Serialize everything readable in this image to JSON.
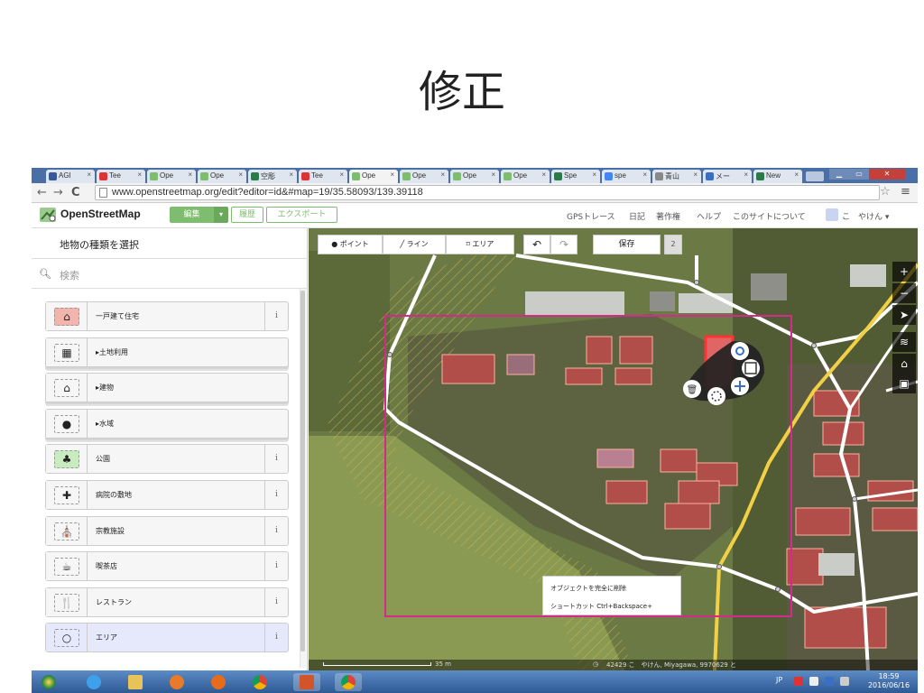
{
  "slide": {
    "title": "修正"
  },
  "browser": {
    "tabs": [
      {
        "label": "AGI",
        "color": "#3b5998"
      },
      {
        "label": "Tee",
        "color": "#d33"
      },
      {
        "label": "Ope",
        "color": "#7ebc6f"
      },
      {
        "label": "Ope",
        "color": "#7ebc6f"
      },
      {
        "label": "空彫",
        "color": "#2a7a4a"
      },
      {
        "label": "Tee",
        "color": "#d33"
      },
      {
        "label": "Ope",
        "color": "#7ebc6f"
      },
      {
        "label": "Ope",
        "color": "#7ebc6f"
      },
      {
        "label": "Ope",
        "color": "#7ebc6f"
      },
      {
        "label": "Ope",
        "color": "#7ebc6f"
      },
      {
        "label": "Spe",
        "color": "#2a7a4a"
      },
      {
        "label": "spe",
        "color": "#4285f4"
      },
      {
        "label": "青山",
        "color": "#888"
      },
      {
        "label": "メー",
        "color": "#3a6fc4"
      },
      {
        "label": "New",
        "color": "#2a7a4a"
      }
    ],
    "active_tab_index": 6,
    "url": "www.openstreetmap.org/edit?editor=id&#map=19/35.58093/139.39118"
  },
  "osm_header": {
    "logo": "OpenStreetMap",
    "edit": "編集",
    "dropdown": "▾",
    "history": "履歴",
    "export": "エクスポート",
    "links": [
      "GPSトレース",
      "日記",
      "著作権",
      "ヘルプ",
      "このサイトについて"
    ],
    "user": "こ　やけん ▾"
  },
  "sidebar": {
    "heading": "地物の種類を選択",
    "search_placeholder": "検索",
    "presets": [
      {
        "label": "一戸建て住宅",
        "icon": "house-icon",
        "info": "i",
        "group": false,
        "bg": "#f2b5ad"
      },
      {
        "label": "▸土地利用",
        "icon": "landuse-icon",
        "info": "",
        "group": true,
        "bg": ""
      },
      {
        "label": "▸建物",
        "icon": "building-icon",
        "info": "",
        "group": true,
        "bg": ""
      },
      {
        "label": "▸水域",
        "icon": "water-icon",
        "info": "",
        "group": true,
        "bg": ""
      },
      {
        "label": "公園",
        "icon": "tree-icon",
        "info": "i",
        "group": false,
        "bg": "#c8ecc0"
      },
      {
        "label": "病院の敷地",
        "icon": "hospital-icon",
        "info": "i",
        "group": false,
        "bg": ""
      },
      {
        "label": "宗教施設",
        "icon": "church-icon",
        "info": "i",
        "group": false,
        "bg": ""
      },
      {
        "label": "喫茶店",
        "icon": "cafe-icon",
        "info": "i",
        "group": false,
        "bg": ""
      },
      {
        "label": "レストラン",
        "icon": "restaurant-icon",
        "info": "i",
        "group": false,
        "bg": ""
      },
      {
        "label": "エリア",
        "icon": "area-icon",
        "info": "i",
        "group": false,
        "bg": ""
      }
    ]
  },
  "map_toolbar": {
    "point": "ポイント",
    "line": "ライン",
    "area": "エリア",
    "undo": "↶",
    "redo": "↷",
    "save": "保存",
    "count": "2"
  },
  "map_controls": [
    "+",
    "−",
    "➤",
    "≋",
    "⌂",
    "▣"
  ],
  "tooltip": {
    "line1": "オブジェクトを完全に削除",
    "line2": "ショートカット Ctrl+Backspace+"
  },
  "status": {
    "scale": "35 m",
    "attribution": "42429 こ　やけん, Miyagawa, 9970629 と"
  },
  "taskbar": {
    "lang": "JP",
    "time": "18:59",
    "date": "2016/06/16"
  },
  "colors": {
    "osm_green": "#7ebc6f",
    "selection": "#d42a8a",
    "building": "#e06666"
  }
}
